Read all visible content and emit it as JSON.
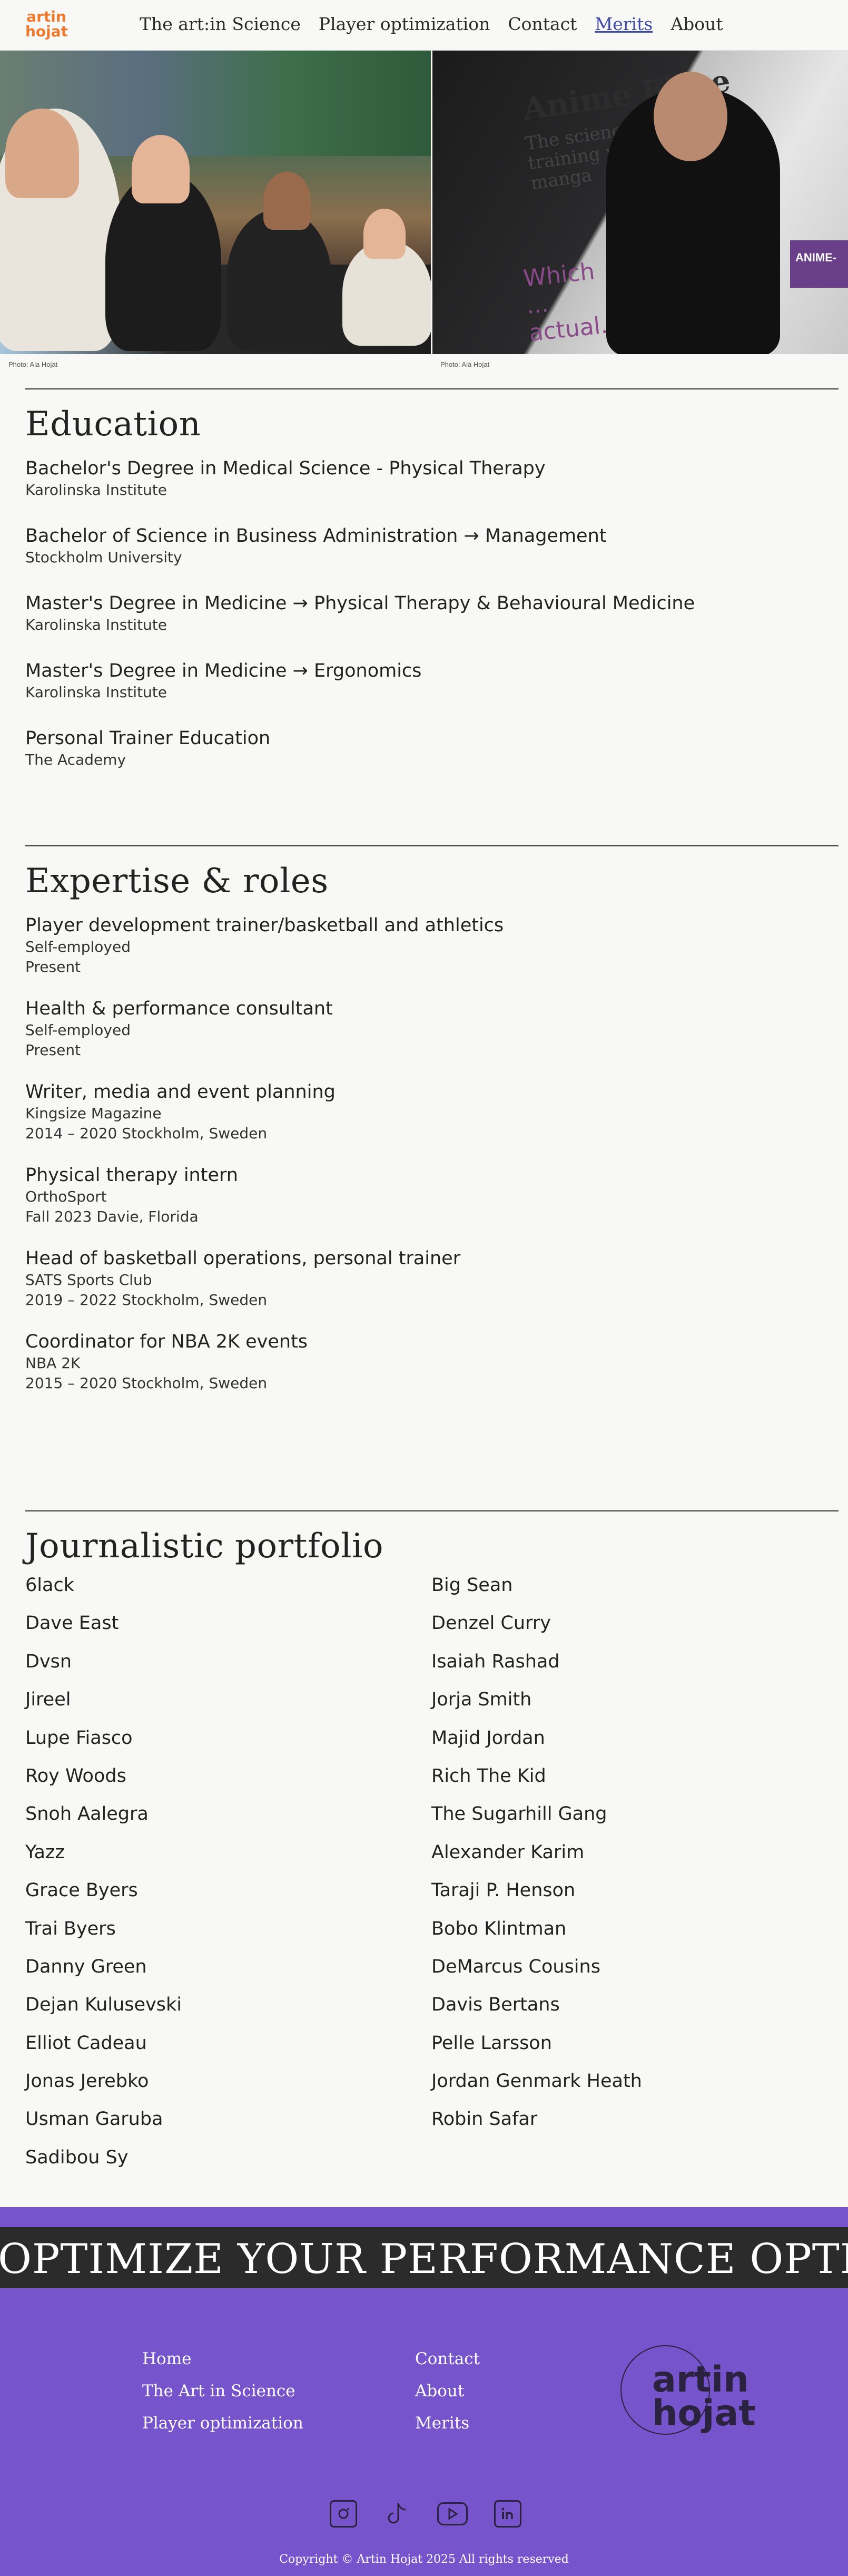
{
  "nav": {
    "logo_line1": "artin",
    "logo_line2": "hojat",
    "links": [
      {
        "label": "The art:in Science"
      },
      {
        "label": "Player optimization"
      },
      {
        "label": "Contact"
      },
      {
        "label": "Merits",
        "active": true
      },
      {
        "label": "About"
      }
    ]
  },
  "hero": {
    "caption_left": "Photo: Ala Hojat",
    "caption_right": "Photo: Ala Hojat",
    "slide_title": "Anime Fitne",
    "slide_sub": "The science behind the training principles in manga",
    "slide_question": "Which ... actual...",
    "slide_badge": "ANIME-"
  },
  "education": {
    "heading": "Education",
    "items": [
      {
        "title": "Bachelor's Degree in Medical Science - Physical Therapy",
        "school": "Karolinska Institute"
      },
      {
        "title": "Bachelor of Science in Business Administration → Management",
        "school": "Stockholm University"
      },
      {
        "title": "Master's Degree in Medicine → Physical Therapy & Behavioural Medicine",
        "school": "Karolinska Institute"
      },
      {
        "title": "Master's Degree in Medicine → Ergonomics",
        "school": "Karolinska Institute"
      },
      {
        "title": "Personal Trainer Education",
        "school": "The Academy"
      }
    ]
  },
  "expertise": {
    "heading": "Expertise & roles",
    "items": [
      {
        "title": "Player development trainer/basketball and athletics",
        "org": "Self-employed",
        "when": "Present"
      },
      {
        "title": "Health & performance consultant",
        "org": "Self-employed",
        "when": "Present"
      },
      {
        "title": "Writer, media and event planning",
        "org": "Kingsize Magazine",
        "when": "2014 – 2020 Stockholm, Sweden"
      },
      {
        "title": "Physical therapy intern",
        "org": "OrthoSport",
        "when": "Fall 2023 Davie, Florida"
      },
      {
        "title": "Head of basketball operations, personal trainer",
        "org": "SATS Sports Club",
        "when": "2019 – 2022 Stockholm, Sweden"
      },
      {
        "title": "Coordinator for NBA 2K events",
        "org": "NBA 2K",
        "when": "2015 – 2020 Stockholm, Sweden"
      }
    ]
  },
  "portfolio": {
    "heading": "Journalistic portfolio",
    "names": [
      "6lack",
      "Big Sean",
      "Dave East",
      "Denzel Curry",
      "Dvsn",
      "Isaiah Rashad",
      "Jireel",
      "Jorja Smith",
      "Lupe Fiasco",
      "Majid Jordan",
      "Roy Woods",
      "Rich The Kid",
      "Snoh Aalegra",
      "The Sugarhill Gang",
      "Yazz",
      "Alexander Karim",
      "Grace Byers",
      "Taraji P. Henson",
      "Trai Byers",
      "Bobo Klintman",
      "Danny Green",
      "DeMarcus Cousins",
      "Dejan Kulusevski",
      "Davis Bertans",
      "Elliot Cadeau",
      "Pelle Larsson",
      "Jonas Jerebko",
      "Jordan Genmark Heath",
      "Usman Garuba",
      "Robin Safar",
      "Sadibou Sy"
    ]
  },
  "footer": {
    "marquee": "OPTIMIZE YOUR PERFORMANCE OPTIMIZE YOUR PERFORMANCE",
    "col1": [
      {
        "label": "Home"
      },
      {
        "label": "The Art in Science"
      },
      {
        "label": "Player optimization"
      }
    ],
    "col2": [
      {
        "label": "Contact"
      },
      {
        "label": "About"
      },
      {
        "label": "Merits"
      }
    ],
    "logo_line1": "artin",
    "logo_line2": "hojat",
    "socials": [
      {
        "icon": "instagram-icon"
      },
      {
        "icon": "tiktok-icon"
      },
      {
        "icon": "youtube-icon"
      },
      {
        "icon": "linkedin-icon"
      }
    ],
    "copyright": "Copyright © Artin Hojat 2025 All rights reserved"
  },
  "colors": {
    "accent_orange": "#ef7a2e",
    "footer_purple": "#7654cb",
    "active_link": "#3d49a6"
  }
}
